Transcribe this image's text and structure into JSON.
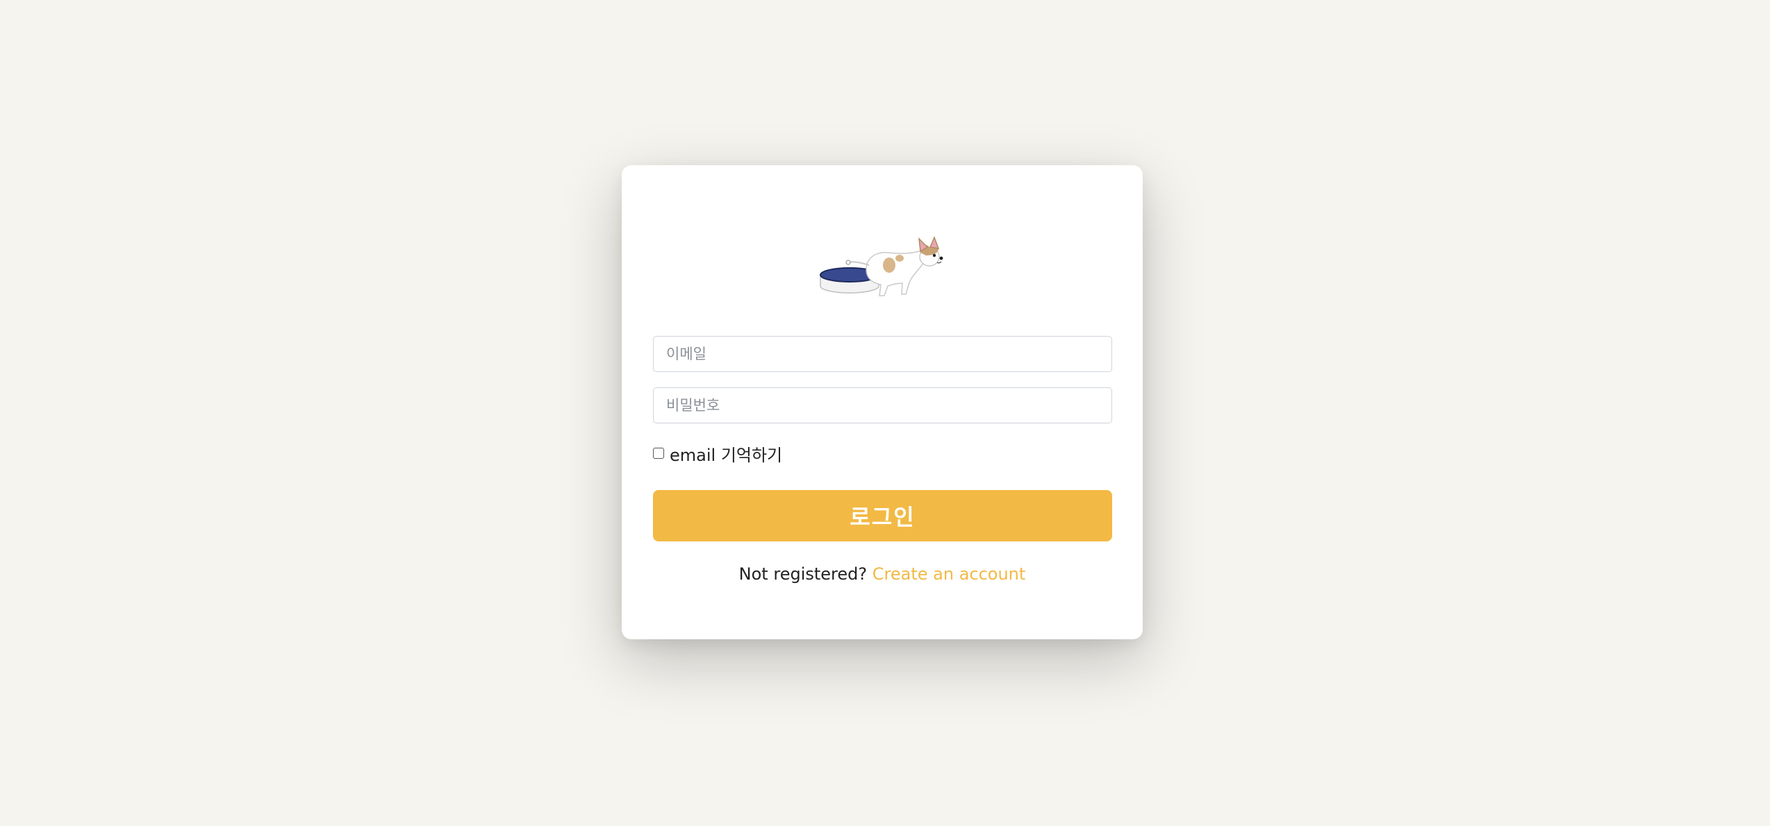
{
  "login": {
    "email_placeholder": "이메일",
    "password_placeholder": "비밀번호",
    "remember_label": "email 기억하기",
    "remember_checked": false,
    "submit_label": "로그인",
    "register_prompt": "Not registered?",
    "register_link": "Create an account"
  },
  "colors": {
    "background": "#f6f4ef",
    "accent": "#f2b944",
    "card": "#ffffff"
  },
  "logo": {
    "icon": "dog-and-bowl-illustration"
  }
}
